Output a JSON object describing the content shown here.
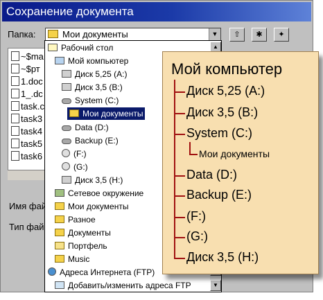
{
  "dialog": {
    "title": "Сохранение документа",
    "folder_label": "Папка:",
    "folder_value": "Мои документы",
    "filename_label": "Имя фай",
    "filetype_label": "Тип фай"
  },
  "toolbar": {
    "up_icon": "up-folder-icon",
    "desktop_icon": "desktop-icon",
    "new_folder_icon": "new-folder-icon"
  },
  "files": [
    "~$ma",
    "~$рт",
    "1.doc",
    "1_.dc",
    "task.c",
    "task3",
    "task4",
    "task5",
    "task6"
  ],
  "dropdown": {
    "items": [
      {
        "label": "Рабочий стол",
        "icon": "desk"
      },
      {
        "label": "Мой компьютер",
        "icon": "comp"
      },
      {
        "label": "Диск 5,25 (A:)",
        "icon": "flop"
      },
      {
        "label": "Диск 3,5 (B:)",
        "icon": "flop"
      },
      {
        "label": "System (C:)",
        "icon": "disk"
      },
      {
        "label": "Мои документы",
        "icon": "fold"
      },
      {
        "label": "Data (D:)",
        "icon": "disk"
      },
      {
        "label": "Backup (E:)",
        "icon": "disk"
      },
      {
        "label": "(F:)",
        "icon": "cd"
      },
      {
        "label": "(G:)",
        "icon": "cd"
      },
      {
        "label": "Диск 3,5 (H:)",
        "icon": "flop"
      },
      {
        "label": "Сетевое окружение",
        "icon": "net"
      },
      {
        "label": "Мои документы",
        "icon": "fold"
      },
      {
        "label": "Разное",
        "icon": "fold"
      },
      {
        "label": "Документы",
        "icon": "fold"
      },
      {
        "label": "Портфель",
        "icon": "fold2"
      },
      {
        "label": "Music",
        "icon": "fold"
      },
      {
        "label": "Адреса Интернета (FTP)",
        "icon": "globe"
      },
      {
        "label": "Добавить/изменить адреса FTP",
        "icon": "ftp"
      }
    ]
  },
  "callout": {
    "title": "Мой компьютер",
    "items": [
      "Диск 5,25 (A:)",
      "Диск 3,5 (B:)",
      "System (C:)",
      "Мои документы",
      "Data (D:)",
      "Backup (E:)",
      "(F:)",
      "(G:)",
      "Диск 3,5 (H:)"
    ]
  },
  "colors": {
    "title_bar": "#0a1a8a",
    "selection": "#0a1a6a",
    "callout_bg": "#f8dfb0",
    "tree_lines": "#a01010"
  }
}
